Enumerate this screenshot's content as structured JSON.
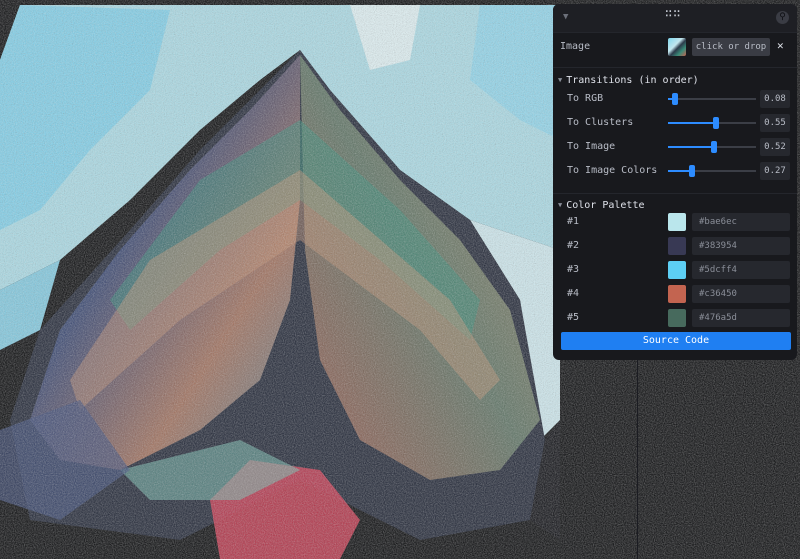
{
  "panel": {
    "collapse_icon": "chevron-down-icon",
    "drag_handle_icon": "drag-handle-icon",
    "drag_handle_glyph": "∷∷",
    "search_icon": "search-icon",
    "image": {
      "label": "Image",
      "drop_label": "click or drop",
      "close_glyph": "✕"
    },
    "transitions": {
      "title": "Transitions (in order)",
      "items": [
        {
          "label": "To RGB",
          "value": "0.08",
          "fraction": 0.08
        },
        {
          "label": "To Clusters",
          "value": "0.55",
          "fraction": 0.55
        },
        {
          "label": "To Image",
          "value": "0.52",
          "fraction": 0.52
        },
        {
          "label": "To Image Colors",
          "value": "0.27",
          "fraction": 0.27
        }
      ]
    },
    "palette": {
      "title": "Color Palette",
      "items": [
        {
          "label": "#1",
          "hex": "#bae6ec"
        },
        {
          "label": "#2",
          "hex": "#383954"
        },
        {
          "label": "#3",
          "hex": "#5dcff4"
        },
        {
          "label": "#4",
          "hex": "#c36450"
        },
        {
          "label": "#5",
          "hex": "#476a5d"
        }
      ]
    },
    "source_button": "Source Code"
  },
  "colors": {
    "accent": "#2d8cff",
    "panel_bg": "#18191d",
    "page_bg": "#050608"
  }
}
